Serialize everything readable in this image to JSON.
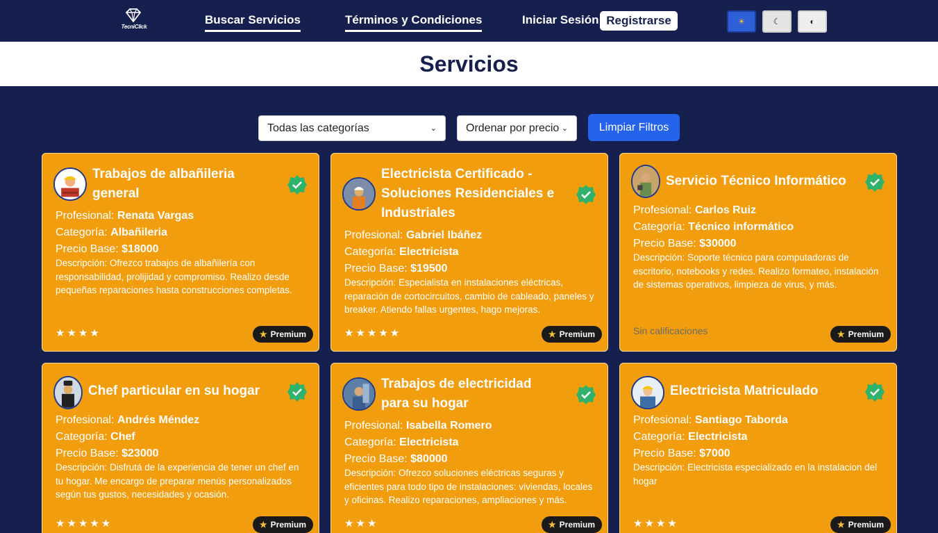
{
  "navbar": {
    "logo_text": "TecniClick",
    "links": {
      "search": "Buscar Servicios",
      "terms": "Términos y Condiciones",
      "login": "Iniciar Sesión",
      "register": "Registrarse"
    },
    "theme": {
      "light_icon": "☀",
      "dark_icon": "☾",
      "dim_icon": "◐"
    }
  },
  "page": {
    "title": "Servicios"
  },
  "filters": {
    "category_selected": "Todas las categorías",
    "order_selected": "Ordenar por precio",
    "clear_label": "Limpiar Filtros"
  },
  "labels": {
    "professional": "Profesional: ",
    "category": "Categoría: ",
    "price": "Precio Base: ",
    "description": "Descripción: ",
    "no_rating": "Sin calificaciones",
    "premium": "Premium"
  },
  "services": [
    {
      "title": "Trabajos de albañileria general",
      "professional": "Renata Vargas",
      "category": "Albañileria",
      "price": "$18000",
      "description": "Ofrezco trabajos de albañilería con responsabilidad, prolijidad y compromiso. Realizo desde pequeñas reparaciones hasta construcciones completas.",
      "stars": "★★★★",
      "rating": 4,
      "badge": "Premium"
    },
    {
      "title": "Electricista Certificado - Soluciones Residenciales e Industriales",
      "professional": "Gabriel Ibáñez",
      "category": "Electricista",
      "price": "$19500",
      "description": "Especialista en instalaciones eléctricas, reparación de cortocircuitos, cambio de cableado, paneles y breaker. Atiendo fallas urgentes, hago mejoras.",
      "stars": "★★★★★",
      "rating": 5,
      "badge": "Premium"
    },
    {
      "title": "Servicio Técnico Informático",
      "professional": "Carlos Ruiz",
      "category": "Técnico informático",
      "price": "$30000",
      "description": "Soporte técnico para computadoras de escritorio, notebooks y redes. Realizo formateo, instalación de sistemas operativos, limpieza de virus, y más.",
      "stars": "",
      "rating": 0,
      "badge": "Premium"
    },
    {
      "title": "Chef particular en su hogar",
      "professional": "Andrés Méndez",
      "category": "Chef",
      "price": "$23000",
      "description": "Disfrutá de la experiencia de tener un chef en tu hogar. Me encargo de preparar menús personalizados según tus gustos, necesidades y ocasión.",
      "stars": "★★★★★",
      "rating": 5,
      "badge": "Premium"
    },
    {
      "title": "Trabajos de electricidad para su hogar",
      "professional": "Isabella Romero",
      "category": "Electricista",
      "price": "$80000",
      "description": "Ofrezco soluciones eléctricas seguras y eficientes para todo tipo de instalaciones: viviendas, locales y oficinas. Realizo reparaciones, ampliaciones y más.",
      "stars": "★★★",
      "rating": 3,
      "badge": "Premium"
    },
    {
      "title": "Electricista Matriculado",
      "professional": "Santiago Taborda",
      "category": "Electricista",
      "price": "$7000",
      "description": "Electricista especializado en la instalacion del hogar",
      "stars": "★★★★",
      "rating": 4,
      "badge": "Premium"
    }
  ]
}
